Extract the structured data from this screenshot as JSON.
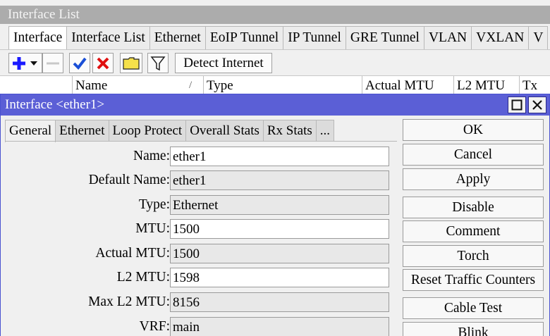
{
  "background_window": {
    "title": "Interface List",
    "tabs": [
      "Interface",
      "Interface List",
      "Ethernet",
      "EoIP Tunnel",
      "IP Tunnel",
      "GRE Tunnel",
      "VLAN",
      "VXLAN",
      "V"
    ],
    "toolbar": {
      "detect_internet_label": "Detect Internet"
    },
    "columns": [
      "Name",
      "Type",
      "Actual MTU",
      "L2 MTU",
      "Tx"
    ]
  },
  "dialog": {
    "title": "Interface <ether1>",
    "tabs": [
      "General",
      "Ethernet",
      "Loop Protect",
      "Overall Stats",
      "Rx Stats",
      "..."
    ],
    "fields": [
      {
        "label": "Name:",
        "value": "ether1",
        "editable": true
      },
      {
        "label": "Default Name:",
        "value": "ether1",
        "editable": false
      },
      {
        "label": "Type:",
        "value": "Ethernet",
        "editable": false
      },
      {
        "label": "MTU:",
        "value": "1500",
        "editable": true
      },
      {
        "label": "Actual MTU:",
        "value": "1500",
        "editable": false
      },
      {
        "label": "L2 MTU:",
        "value": "1598",
        "editable": true
      },
      {
        "label": "Max L2 MTU:",
        "value": "8156",
        "editable": false
      },
      {
        "label": "VRF:",
        "value": "main",
        "editable": false
      }
    ],
    "buttons": [
      "OK",
      "Cancel",
      "Apply",
      "Disable",
      "Comment",
      "Torch",
      "Reset Traffic Counters",
      "Cable Test",
      "Blink"
    ]
  },
  "colors": {
    "dialog_titlebar": "#5b5fd6",
    "bg_titlebar": "#acacac",
    "add_icon": "#1a1aff",
    "check_icon": "#1a4fd6",
    "remove_icon": "#e01010",
    "folder_icon": "#f5e04a"
  }
}
